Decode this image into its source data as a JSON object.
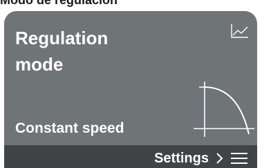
{
  "header": {
    "caption": "Modo de regulación"
  },
  "screen": {
    "title": "Regulation\nmode",
    "status_value": "Constant speed",
    "chart_icon": "line-chart-icon",
    "curve_icon": "constant-speed-curve-icon"
  },
  "footer": {
    "settings_label": "Settings",
    "chevron_icon": "chevron-right-icon",
    "menu_icon": "hamburger-menu-icon"
  },
  "colors": {
    "screen_bg": "#6f7477",
    "footer_bg": "#414446",
    "text": "#ffffff"
  }
}
